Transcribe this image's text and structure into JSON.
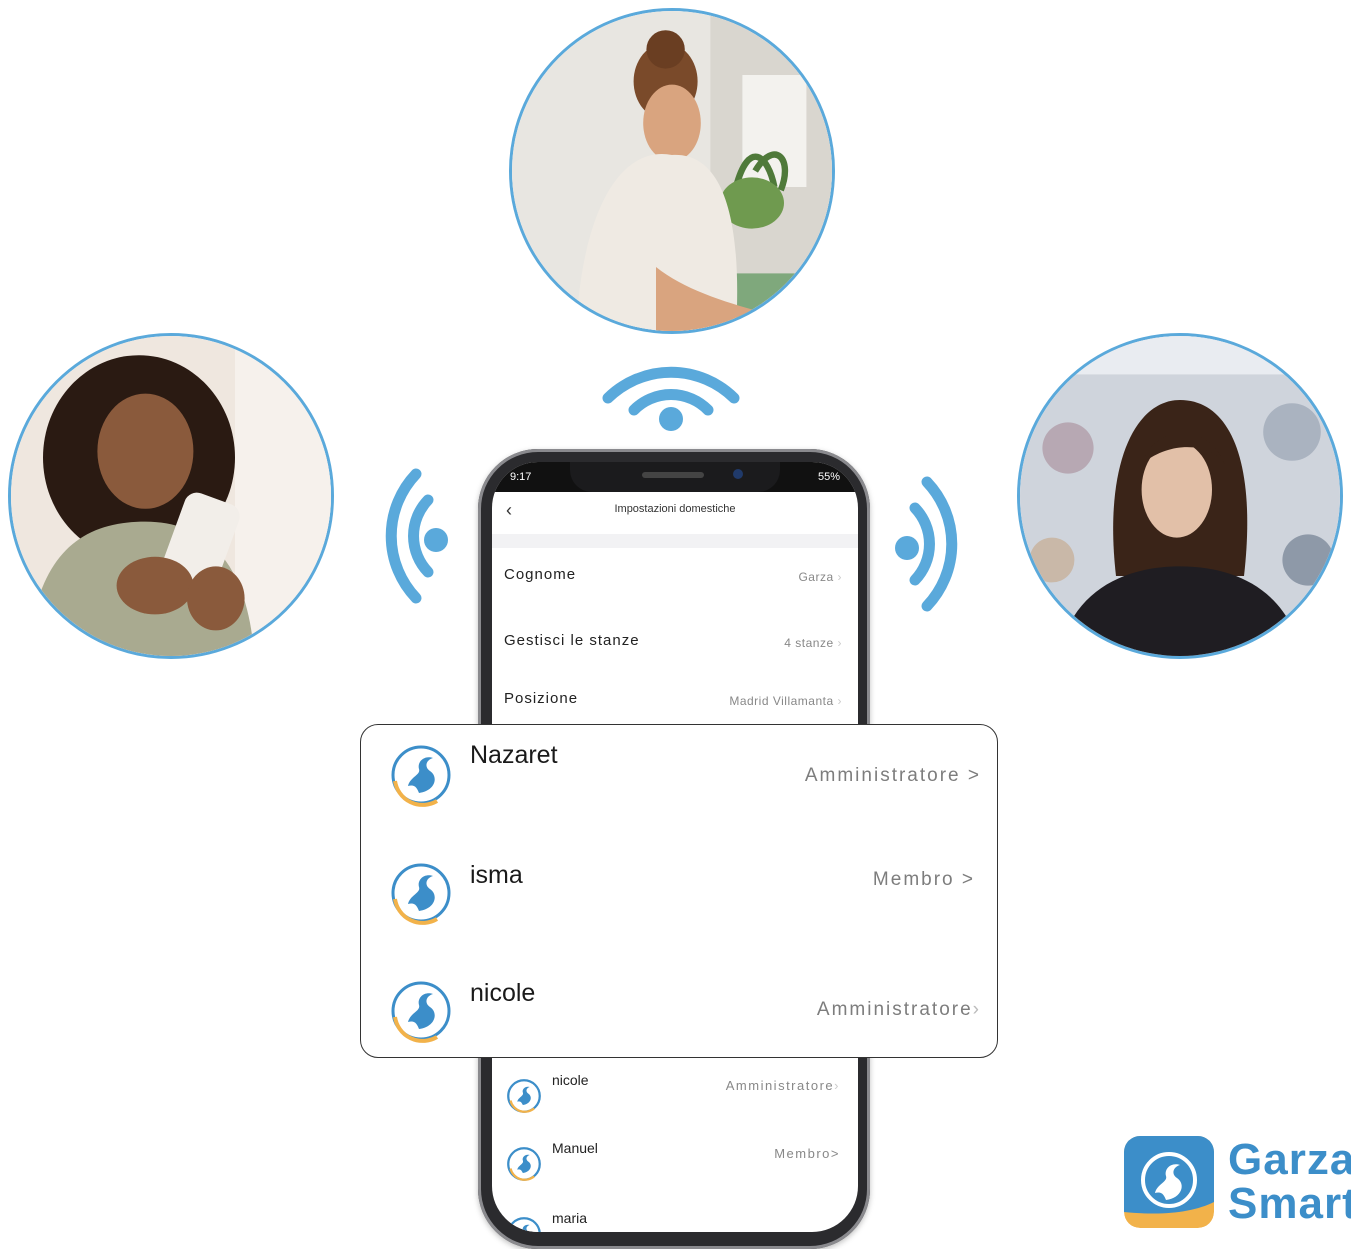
{
  "status_bar": {
    "time": "9:17",
    "battery": "55%"
  },
  "app_screen": {
    "title": "Impostazioni domestiche",
    "settings": [
      {
        "label": "Cognome",
        "value": "Garza"
      },
      {
        "label": "Gestisci le stanze",
        "value": "4 stanze"
      },
      {
        "label": "Posizione",
        "value": "Madrid Villamanta"
      }
    ],
    "members": [
      {
        "name": "nicole",
        "role": "Amministratore"
      },
      {
        "name": "Manuel",
        "role": "Membro"
      },
      {
        "name": "maria",
        "role": ""
      }
    ]
  },
  "members_card": [
    {
      "name": "Nazaret",
      "role": "Amministratore"
    },
    {
      "name": "isma",
      "role": "Membro"
    },
    {
      "name": "nicole",
      "role": "Amministratore"
    }
  ],
  "chevron": ">",
  "brand": {
    "line1": "Garza",
    "line2": "Smart",
    "color": "#3c8ec9",
    "accent": "#f2b24a"
  },
  "accent_color": "#5aa9db",
  "icons": [
    "wifi-icon",
    "heron-avatar-icon",
    "back-arrow-icon",
    "chevron-right-icon"
  ]
}
